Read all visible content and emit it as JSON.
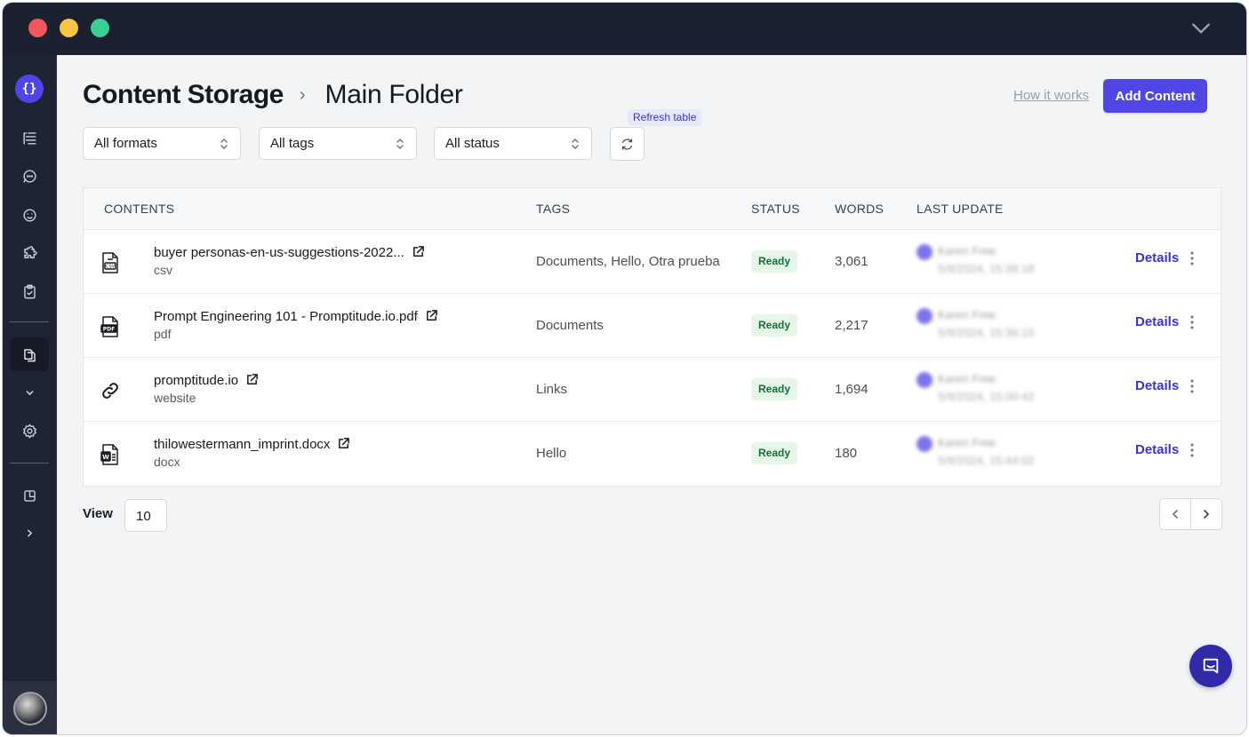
{
  "breadcrumb": {
    "root": "Content Storage",
    "separator": "›",
    "current": "Main Folder"
  },
  "header": {
    "how_it_works": "How it works",
    "add_content": "Add Content"
  },
  "filters": {
    "formats": "All formats",
    "tags": "All tags",
    "status": "All status",
    "refresh_tooltip": "Refresh table"
  },
  "table": {
    "columns": [
      "CONTENTS",
      "TAGS",
      "STATUS",
      "WORDS",
      "LAST UPDATE"
    ],
    "rows": [
      {
        "icon": "csv-file-icon",
        "name": "buyer personas-en-us-suggestions-2022...",
        "type": "csv",
        "tags": "Documents, Hello, Otra prueba",
        "status": "Ready",
        "words": "3,061",
        "updated_by": "Karen Free",
        "updated_at": "5/9/2024, 15:38:18",
        "action": "Details"
      },
      {
        "icon": "pdf-file-icon",
        "name": "Prompt Engineering 101 - Promptitude.io.pdf",
        "type": "pdf",
        "tags": "Documents",
        "status": "Ready",
        "words": "2,217",
        "updated_by": "Karen Free",
        "updated_at": "5/9/2024, 15:36:15",
        "action": "Details"
      },
      {
        "icon": "link-icon",
        "name": "promptitude.io",
        "type": "website",
        "tags": "Links",
        "status": "Ready",
        "words": "1,694",
        "updated_by": "Karen Free",
        "updated_at": "5/9/2024, 15:00:42",
        "action": "Details"
      },
      {
        "icon": "docx-file-icon",
        "name": "thilowestermann_imprint.docx",
        "type": "docx",
        "tags": "Hello",
        "status": "Ready",
        "words": "180",
        "updated_by": "Karen Free",
        "updated_at": "5/9/2024, 15:44:02",
        "action": "Details"
      }
    ]
  },
  "footer": {
    "view_label": "View",
    "page_size": "10"
  },
  "sidebar": {
    "logo": "{}"
  },
  "colors": {
    "accent": "#4f46e5",
    "sidebar_bg": "#1e2433",
    "titlebar_bg": "#1b2130",
    "ready_bg": "#e3f6e8",
    "ready_text": "#1f6b3a"
  }
}
